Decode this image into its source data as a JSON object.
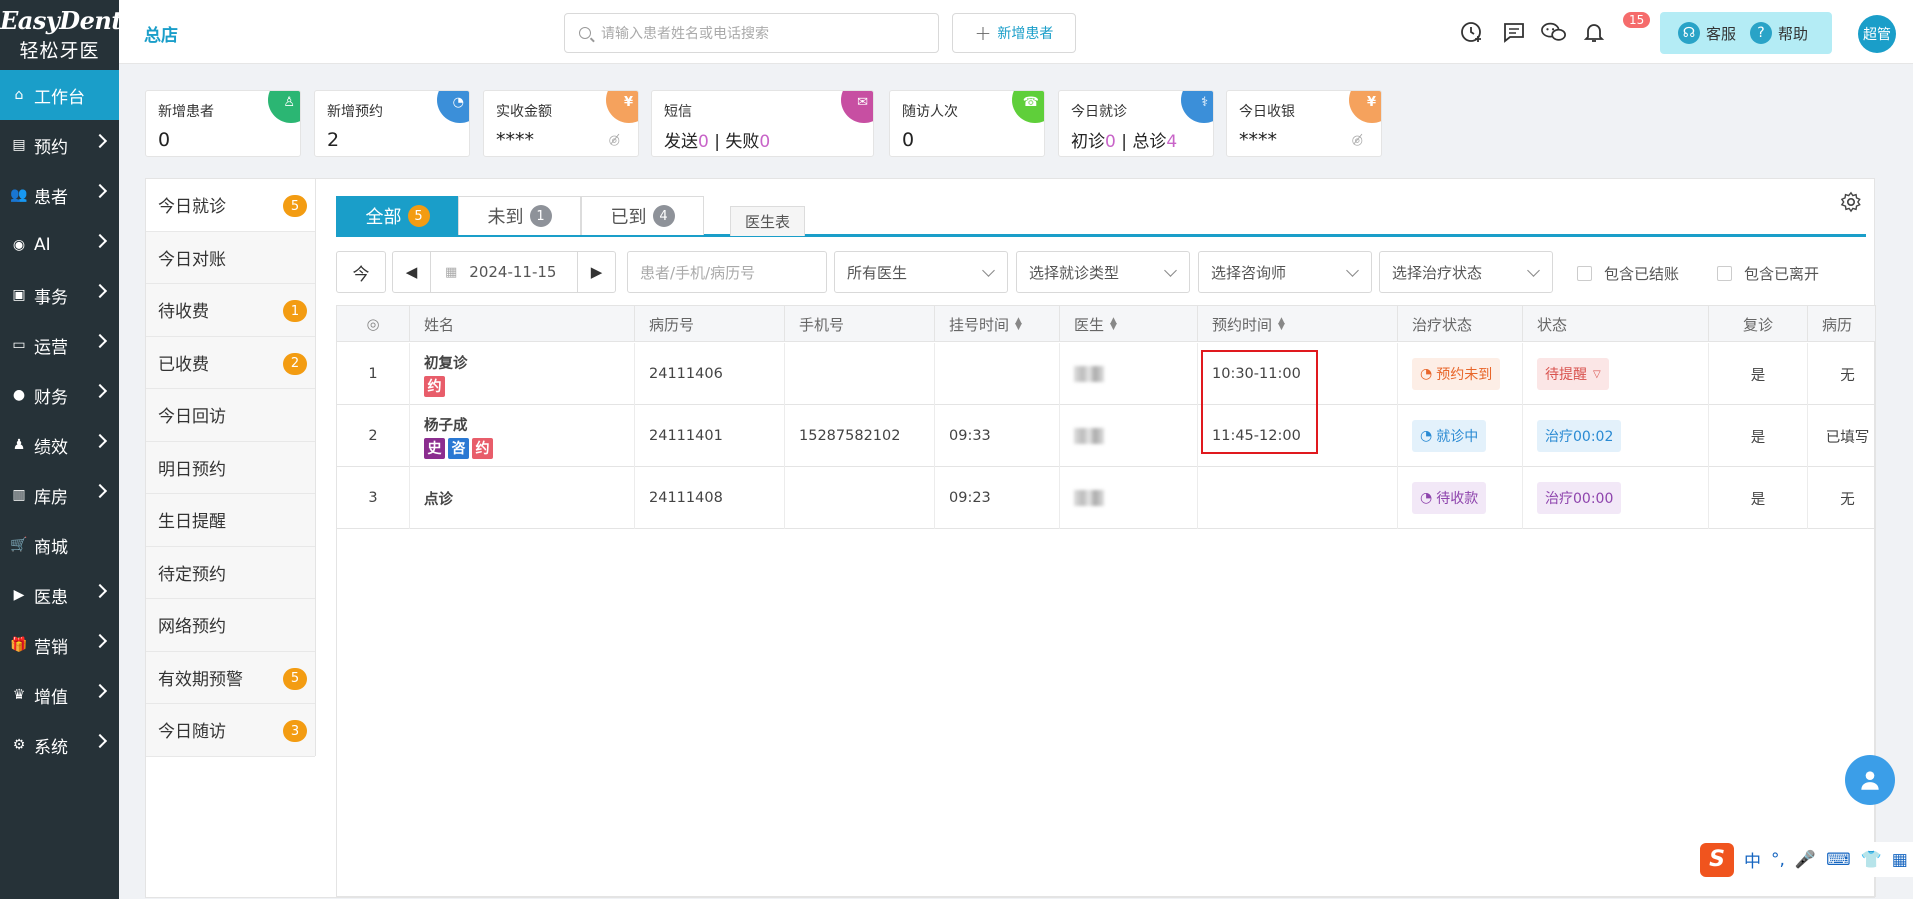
{
  "logo": {
    "en": "EasyDent",
    "cn": "轻松牙医"
  },
  "sidebar": {
    "items": [
      {
        "label": "工作台",
        "icon": "home-icon",
        "active": true,
        "chevron": false
      },
      {
        "label": "预约",
        "icon": "calendar-icon",
        "chevron": true
      },
      {
        "label": "患者",
        "icon": "users-icon",
        "chevron": true
      },
      {
        "label": "AI",
        "icon": "robot-icon",
        "chevron": true
      },
      {
        "label": "事务",
        "icon": "clipboard-icon",
        "chevron": true
      },
      {
        "label": "运营",
        "icon": "monitor-icon",
        "chevron": true
      },
      {
        "label": "财务",
        "icon": "coin-icon",
        "chevron": true
      },
      {
        "label": "绩效",
        "icon": "user-check-icon",
        "chevron": true
      },
      {
        "label": "库房",
        "icon": "warehouse-icon",
        "chevron": true
      },
      {
        "label": "商城",
        "icon": "cart-icon",
        "chevron": false
      },
      {
        "label": "医患",
        "icon": "video-icon",
        "chevron": true
      },
      {
        "label": "营销",
        "icon": "gift-icon",
        "chevron": true
      },
      {
        "label": "增值",
        "icon": "crown-icon",
        "chevron": true
      },
      {
        "label": "系统",
        "icon": "gear-icon",
        "chevron": true
      }
    ]
  },
  "topbar": {
    "store": "总店",
    "search_placeholder": "请输入患者姓名或电话搜索",
    "add_patient": "新增患者",
    "notification_count": "15",
    "service": "客服",
    "help": "帮助",
    "user": "超管"
  },
  "stats": [
    {
      "title": "新增患者",
      "value": "0",
      "color": "#2bb673",
      "icon": "user-plus-icon"
    },
    {
      "title": "新增预约",
      "value": "2",
      "color": "#3b8fd9",
      "icon": "clock-plus-icon"
    },
    {
      "title": "实收金额",
      "value": "****",
      "color": "#f5a25d",
      "icon": "money-icon",
      "hidden": true
    },
    {
      "title": "短信",
      "sent_label": "发送",
      "sent": "0",
      "sep": " | ",
      "fail_label": "失败",
      "fail": "0",
      "color": "#c74fa2",
      "icon": "mail-icon"
    },
    {
      "title": "随访人次",
      "value": "0",
      "color": "#5fcf3a",
      "icon": "phone-icon"
    },
    {
      "title": "今日就诊",
      "first_label": "初诊",
      "first": "0",
      "sep": " | ",
      "total_label": "总诊",
      "total": "4",
      "color": "#3b8fd9",
      "icon": "stethoscope-icon"
    },
    {
      "title": "今日收银",
      "value": "****",
      "color": "#f5a25d",
      "icon": "cash-icon",
      "hidden": true
    }
  ],
  "left_menu": [
    {
      "label": "今日就诊",
      "badge": "5",
      "active": true
    },
    {
      "label": "今日对账",
      "badge": null
    },
    {
      "label": "待收费",
      "badge": "1"
    },
    {
      "label": "已收费",
      "badge": "2"
    },
    {
      "label": "今日回访",
      "badge": null
    },
    {
      "label": "明日预约",
      "badge": null
    },
    {
      "label": "生日提醒",
      "badge": null
    },
    {
      "label": "待定预约",
      "badge": null
    },
    {
      "label": "网络预约",
      "badge": null
    },
    {
      "label": "有效期预警",
      "badge": "5"
    },
    {
      "label": "今日随访",
      "badge": "3"
    }
  ],
  "tabs": [
    {
      "label": "全部",
      "count": "5",
      "active": true
    },
    {
      "label": "未到",
      "count": "1"
    },
    {
      "label": "已到",
      "count": "4"
    }
  ],
  "doctor_tab": "医生表",
  "filters": {
    "today": "今",
    "date": "2024-11-15",
    "patient_placeholder": "患者/手机/病历号",
    "doctor": "所有医生",
    "visit_type": "选择就诊类型",
    "consultant": "选择咨询师",
    "treatment_status": "选择治疗状态",
    "include_settled": "包含已结账",
    "include_left": "包含已离开"
  },
  "table": {
    "headers": [
      "",
      "姓名",
      "病历号",
      "手机号",
      "挂号时间",
      "医生",
      "预约时间",
      "治疗状态",
      "状态",
      "复诊",
      "病历"
    ],
    "rows": [
      {
        "no": "1",
        "name": "初复诊",
        "tags": [
          {
            "t": "约",
            "c": "#e85d6a"
          }
        ],
        "record": "24111406",
        "phone": "",
        "reg_time": "",
        "appt": "10:30-11:00",
        "treat": "预约未到",
        "treat_bg": "#fdeee6",
        "treat_color": "#e8662a",
        "status": "待提醒",
        "status_bg": "#fbe6e6",
        "status_color": "#d9534f",
        "return": "是",
        "medrec": "无"
      },
      {
        "no": "2",
        "name": "杨子成",
        "tags": [
          {
            "t": "史",
            "c": "#8b2d8f"
          },
          {
            "t": "咨",
            "c": "#2a78d3"
          },
          {
            "t": "约",
            "c": "#e85d6a"
          }
        ],
        "record": "24111401",
        "phone": "15287582102",
        "reg_time": "09:33",
        "appt": "11:45-12:00",
        "treat": "就诊中",
        "treat_bg": "#e3f1fb",
        "treat_color": "#2a8ad3",
        "status": "治疗00:02",
        "status_bg": "#e3f1fb",
        "status_color": "#2a8ad3",
        "return": "是",
        "medrec": "已填写"
      },
      {
        "no": "3",
        "name": "点诊",
        "tags": [],
        "record": "24111408",
        "phone": "",
        "reg_time": "09:23",
        "appt": "",
        "treat": "待收款",
        "treat_bg": "#f2e8f7",
        "treat_color": "#8e44ad",
        "status": "治疗00:00",
        "status_bg": "#f2e8f7",
        "status_color": "#8e44ad",
        "return": "是",
        "medrec": "无"
      }
    ]
  },
  "ime": {
    "logo": "S",
    "mode": "中"
  }
}
